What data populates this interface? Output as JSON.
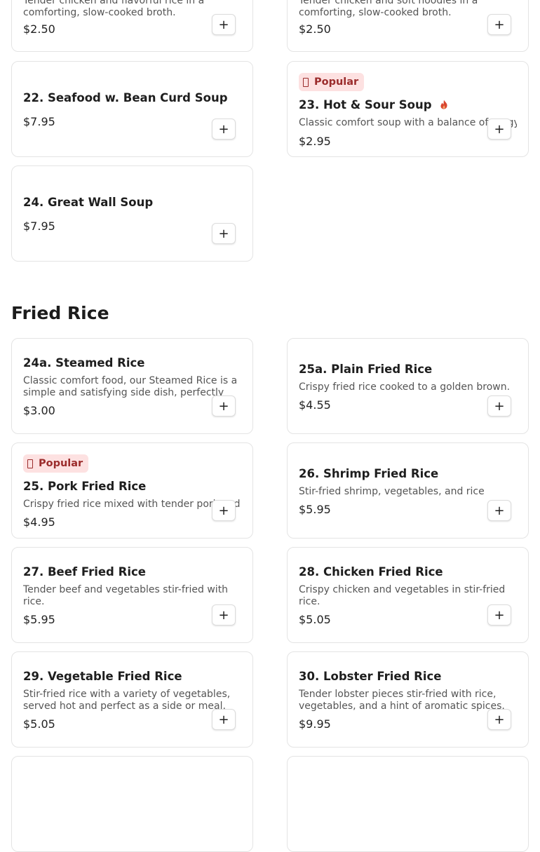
{
  "sections": [
    {
      "title": "Fried Rice"
    }
  ],
  "badge_label": "Popular",
  "add_symbol": "+",
  "items": [
    {
      "name": "",
      "description": "Tender chicken and flavorful rice in a comforting, slow-cooked broth.",
      "price": "$2.50"
    },
    {
      "name": "",
      "description": "Tender chicken and soft noodles in a comforting, slow-cooked broth.",
      "price": "$2.50"
    },
    {
      "name": "22. Seafood w. Bean Curd Soup",
      "description": "",
      "price": "$7.95"
    },
    {
      "name": "23. Hot & Sour Soup",
      "description": "Classic comfort soup with a balance of tangy and spicy flavors.",
      "price": "$2.95",
      "popular": true,
      "spicy": true
    },
    {
      "name": "24. Great Wall Soup",
      "description": "",
      "price": "$7.95"
    },
    {
      "name": "24a. Steamed Rice",
      "description": "Classic comfort food, our Steamed Rice is a simple and satisfying side dish, perfectly cooked and fluffy.",
      "price": "$3.00"
    },
    {
      "name": "25a. Plain Fried Rice",
      "description": "Crispy fried rice cooked to a golden brown.",
      "price": "$4.55"
    },
    {
      "name": "25. Pork Fried Rice",
      "description": "Crispy fried rice mixed with tender pork and vegetables.",
      "price": "$4.95",
      "popular": true
    },
    {
      "name": "26. Shrimp Fried Rice",
      "description": "Stir-fried shrimp, vegetables, and rice",
      "price": "$5.95"
    },
    {
      "name": "27. Beef Fried Rice",
      "description": "Tender beef and vegetables stir-fried with rice.",
      "price": "$5.95"
    },
    {
      "name": "28. Chicken Fried Rice",
      "description": "Crispy chicken and vegetables in stir-fried rice.",
      "price": "$5.05"
    },
    {
      "name": "29. Vegetable Fried Rice",
      "description": "Stir-fried rice with a variety of vegetables, served hot and perfect as a side or meal.",
      "price": "$5.05"
    },
    {
      "name": "30. Lobster Fried Rice",
      "description": "Tender lobster pieces stir-fried with rice, vegetables, and a hint of aromatic spices.",
      "price": "$9.95"
    }
  ]
}
